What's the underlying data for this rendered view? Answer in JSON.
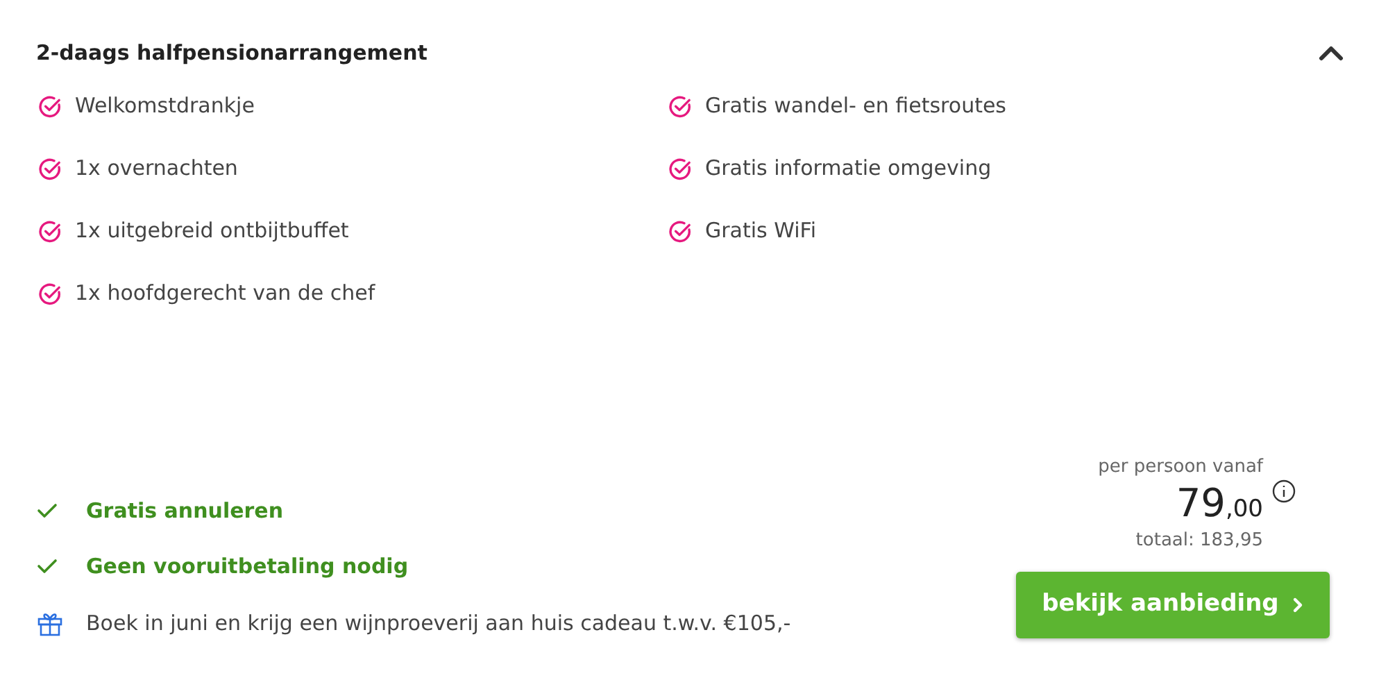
{
  "offer": {
    "title": "2-daags halfpensionarrangement",
    "expanded": true,
    "feature_columns": [
      [
        "Welkomstdrankje",
        "1x overnachten",
        "1x uitgebreid ontbijtbuffet",
        "1x hoofdgerecht van de chef"
      ],
      [
        "Gratis wandel- en fietsroutes",
        "Gratis informatie omgeving",
        "Gratis WiFi"
      ]
    ],
    "conditions": [
      {
        "kind": "check",
        "text": "Gratis annuleren"
      },
      {
        "kind": "check",
        "text": "Geen vooruitbetaling nodig"
      },
      {
        "kind": "gift",
        "text": "Boek in juni en krijg een wijnproeverij aan huis cadeau t.w.v. €105,-"
      }
    ],
    "price": {
      "label": "per persoon vanaf",
      "whole": "79",
      "fraction": ",00",
      "total": "totaal: 183,95"
    },
    "button": "bekijk aanbieding"
  }
}
